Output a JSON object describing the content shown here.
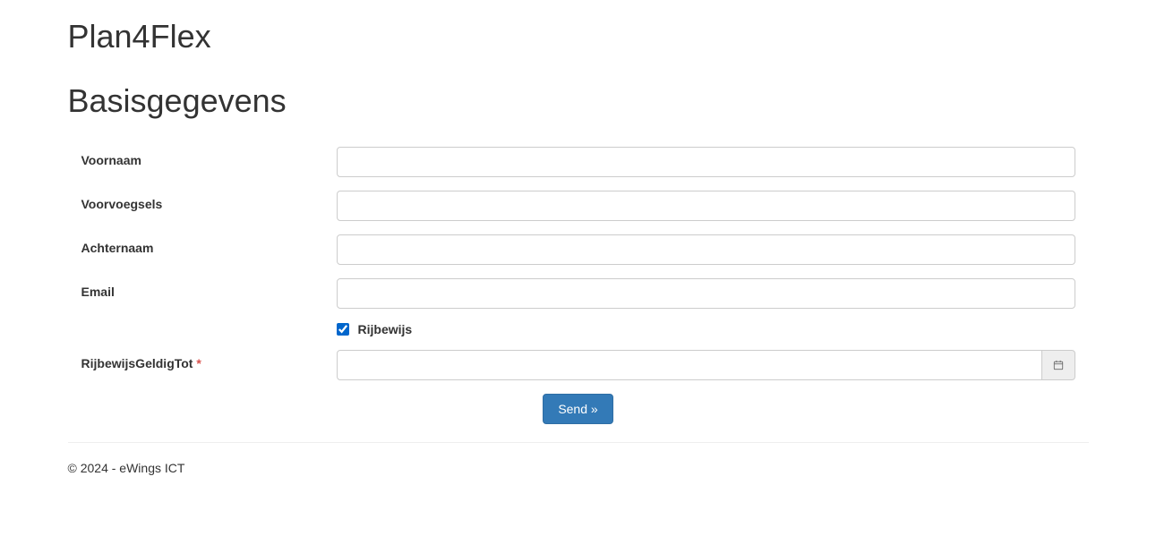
{
  "header": {
    "title": "Plan4Flex"
  },
  "section": {
    "title": "Basisgegevens"
  },
  "form": {
    "voornaam": {
      "label": "Voornaam",
      "value": ""
    },
    "voorvoegsels": {
      "label": "Voorvoegsels",
      "value": ""
    },
    "achternaam": {
      "label": "Achternaam",
      "value": ""
    },
    "email": {
      "label": "Email",
      "value": ""
    },
    "rijbewijs": {
      "label": "Rijbewijs",
      "checked": true
    },
    "rijbewijsGeldigTot": {
      "label": "RijbewijsGeldigTot",
      "required_mark": "*",
      "value": ""
    },
    "submit": {
      "label": "Send »"
    }
  },
  "footer": {
    "text": "© 2024 - eWings ICT"
  }
}
